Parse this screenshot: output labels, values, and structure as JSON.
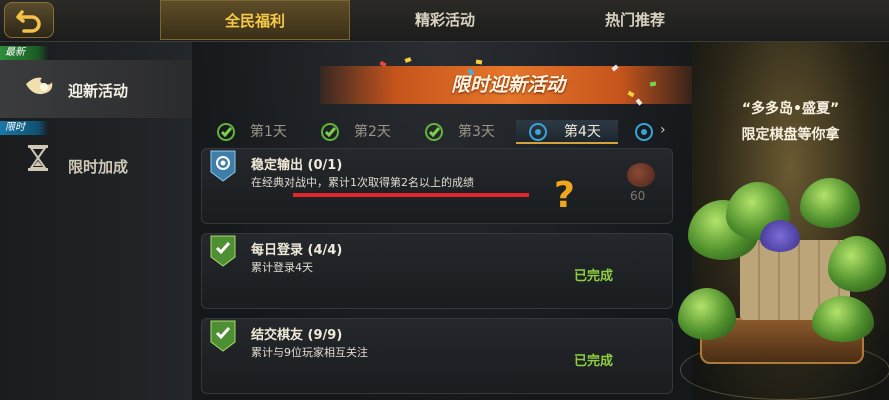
{
  "top_tabs": [
    "全民福利",
    "精彩活动",
    "热门推荐"
  ],
  "sidebar": {
    "items": [
      {
        "tag": "最新",
        "label": "迎新活动",
        "icon": "flame-icon",
        "active": true
      },
      {
        "tag": "限时",
        "label": "限时加成",
        "icon": "hourglass-icon",
        "active": false
      }
    ]
  },
  "banner": {
    "title": "限时迎新活动"
  },
  "day_tabs": [
    {
      "label": "第1天",
      "state": "complete",
      "icon": "check-icon"
    },
    {
      "label": "第2天",
      "state": "complete",
      "icon": "check-icon"
    },
    {
      "label": "第3天",
      "state": "complete",
      "icon": "check-icon"
    },
    {
      "label": "第4天",
      "state": "current",
      "icon": "target-icon"
    },
    {
      "label": "",
      "state": "upcoming",
      "icon": "target-icon"
    }
  ],
  "tasks": [
    {
      "title": "稳定输出",
      "progress": "(0/1)",
      "desc": "在经典对战中，累计1次取得第2名以上的成绩",
      "status": "",
      "reward": "60",
      "annotation": "?"
    },
    {
      "title": "每日登录",
      "progress": "(4/4)",
      "desc": "累计登录4天",
      "status": "已完成"
    },
    {
      "title": "结交棋友",
      "progress": "(9/9)",
      "desc": "累计与9位玩家相互关注",
      "status": "已完成"
    }
  ],
  "promo": {
    "line1": "“多多岛•盛夏”",
    "line2": "限定棋盘等你拿"
  },
  "colors": {
    "accent_gold": "#f7c948",
    "complete_green": "#8fcf3f",
    "banner_orange": "#e6762a",
    "annotation_red": "#e0262a",
    "annotation_orange": "#f0a71c"
  }
}
